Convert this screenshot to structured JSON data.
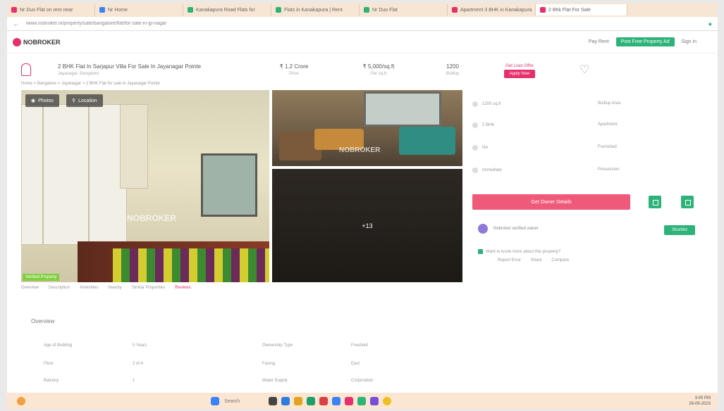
{
  "browser": {
    "tabs": [
      {
        "label": "Nr Duo Flat on rent near",
        "color": "#e5306b"
      },
      {
        "label": "Nr Home",
        "color": "#3b82f6"
      },
      {
        "label": "Kanakapura Road Flats for",
        "color": "#2db37a"
      },
      {
        "label": "Flats in Kanakapura | Rent",
        "color": "#2db37a"
      },
      {
        "label": "Nr Duo Flat",
        "color": "#2db37a"
      },
      {
        "label": "Apartment 3 BHK in Kanakapura",
        "color": "#e5306b"
      },
      {
        "label": "2 Bhk Flat For Sale",
        "color": "#e5306b"
      }
    ],
    "url": "www.nobroker.in/property/sale/bangalore/flat/for-sale-in-jp-nagar"
  },
  "header": {
    "logo": "NOBROKER",
    "links": [
      "Pay Rent",
      "Sign in"
    ],
    "cta": "Post Free Property Ad"
  },
  "property": {
    "title": "2 BHK Flat In Sarjapur Villa For Sale In Jayanagar Pointe",
    "subtitle": "Jayanagar, Bangalore",
    "stats": [
      {
        "value": "₹ 1.2 Crore",
        "label": "Price"
      },
      {
        "value": "₹ 5,000/sq.ft",
        "label": "Per sq.ft"
      },
      {
        "value": "1200",
        "label": "Builtup"
      }
    ],
    "cta_label": "Get Loan Offer",
    "cta_button": "Apply Now",
    "breadcrumbs": "Home > Bangalore > Jayanagar > 2 BHK Flat for sale in Jayanagar Pointe"
  },
  "gallery": {
    "chips": [
      "Photos",
      "Location"
    ],
    "watermark": "NOBROKER",
    "badge": "Verified Property",
    "more_label": "+13"
  },
  "details": {
    "rows": [
      {
        "label": "1200 sq.ft",
        "value": "Builtup Area"
      },
      {
        "label": "2 BHK",
        "value": "Apartment"
      },
      {
        "label": "NA",
        "value": "Furnished"
      },
      {
        "label": "Immediate",
        "value": "Possession"
      }
    ],
    "contact_button": "Get Owner Details",
    "owner_name": "Nobroker verified owner",
    "follow_button": "Shortlist",
    "tip_text": "Want to know more about this property?",
    "tip_links": [
      "Report Error",
      "Share",
      "Compare"
    ]
  },
  "page_tabs": [
    "Overview",
    "Description",
    "Amenities",
    "Nearby",
    "Similar Properties",
    "Reviews"
  ],
  "overview": {
    "heading": "Overview",
    "items": [
      {
        "label": "Age of Building",
        "value": "5 Years"
      },
      {
        "label": "Ownership Type",
        "value": "Freehold"
      },
      {
        "label": "Floor",
        "value": "2 of 4"
      },
      {
        "label": "Facing",
        "value": "East"
      },
      {
        "label": "Balcony",
        "value": "1"
      },
      {
        "label": "Water Supply",
        "value": "Corporation"
      }
    ]
  },
  "taskbar": {
    "search": "Search",
    "time": "3:45 PM",
    "date": "26-09-2023"
  }
}
